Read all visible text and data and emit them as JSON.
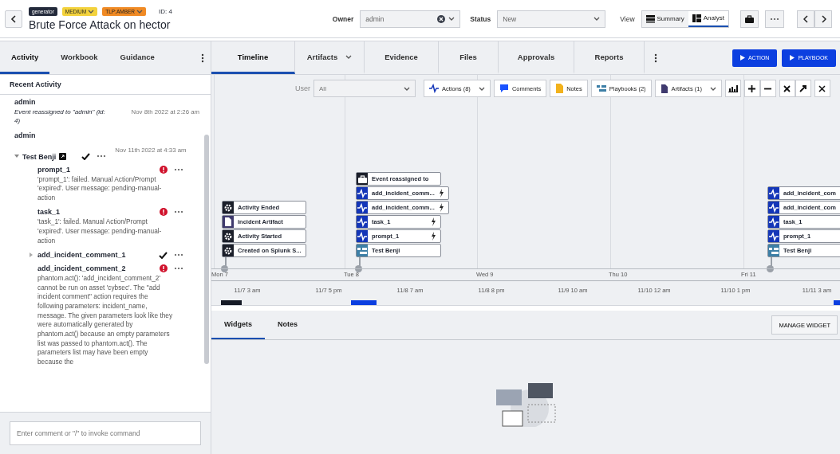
{
  "header": {
    "badges": [
      {
        "label": "generator",
        "kind": "tag",
        "color": "#232a3b"
      },
      {
        "label": "MEDIUM",
        "kind": "dropdown",
        "color": "#f3d23c"
      },
      {
        "label": "TLP:AMBER",
        "kind": "dropdown",
        "color": "#f08a24"
      }
    ],
    "id": "ID: 4",
    "title": "Brute Force Attack on hector",
    "owner": {
      "label": "Owner",
      "value": "admin"
    },
    "status": {
      "label": "Status",
      "value": "New"
    },
    "view": {
      "label": "View",
      "options": [
        {
          "label": "Summary",
          "kind": "summary",
          "selected": false
        },
        {
          "label": "Analyst",
          "kind": "analyst",
          "selected": true
        }
      ]
    }
  },
  "left_tabs": [
    {
      "label": "Activity",
      "selected": true
    },
    {
      "label": "Workbook",
      "selected": false
    },
    {
      "label": "Guidance",
      "selected": false
    }
  ],
  "recent_activity": {
    "title": "Recent Activity",
    "entries": [
      {
        "user": "admin",
        "kind": "message",
        "message": "Event reassigned to \"admin\" (id: 4)",
        "time": "Nov 8th 2022 at 2:26 am"
      },
      {
        "user": "admin",
        "kind": "playbook",
        "playbook": "Test Benji",
        "expanded": true,
        "failed": false,
        "time": "Nov 11th 2022 at 4:33 am",
        "children": [
          {
            "name": "prompt_1",
            "failed": true,
            "description": "'prompt_1': failed. Manual Action/Prompt 'expired'. User message: pending-manual-action"
          },
          {
            "name": "task_1",
            "failed": true,
            "description": "'task_1': failed. Manual Action/Prompt 'expired'. User message: pending-manual-action"
          },
          {
            "name": "add_incident_comment_1",
            "failed": false,
            "expanded": false
          },
          {
            "name": "add_incident_comment_2",
            "failed": true,
            "description": "phantom.act(): 'add_incident_comment_2' cannot be run on asset 'cybsec'. The \"add incident comment\" action requires the following parameters: incident_name, message. The given parameters look like they were automatically generated by phantom.act() because an empty parameters list was passed to phantom.act(). The parameters list may have been empty because the"
          }
        ]
      }
    ]
  },
  "comment": {
    "placeholder": "Enter comment or \"/\" to invoke command"
  },
  "main_tabs": [
    {
      "label": "Timeline",
      "selected": true,
      "dropdown": false
    },
    {
      "label": "Artifacts",
      "selected": false,
      "dropdown": true
    },
    {
      "label": "Evidence",
      "selected": false,
      "dropdown": false
    },
    {
      "label": "Files",
      "selected": false,
      "dropdown": false
    },
    {
      "label": "Approvals",
      "selected": false,
      "dropdown": false
    },
    {
      "label": "Reports",
      "selected": false,
      "dropdown": false
    }
  ],
  "buttons": [
    "ACTION",
    "PLAYBOOK"
  ],
  "timeline": {
    "user_filter": {
      "label": "User",
      "value": "All"
    },
    "filters": [
      {
        "label": "Actions (8)",
        "kind": "action",
        "dropdown": true
      },
      {
        "label": "Comments",
        "kind": "comment",
        "dropdown": false
      },
      {
        "label": "Notes",
        "kind": "note",
        "dropdown": false
      },
      {
        "label": "Playbooks (2)",
        "kind": "playbook",
        "dropdown": false
      },
      {
        "label": "Artifacts (1)",
        "kind": "artifact",
        "dropdown": true
      }
    ],
    "groups": [
      {
        "events": [
          {
            "label": "Activity Ended",
            "kind": "system",
            "bolt": false
          },
          {
            "label": "incident Artifact",
            "kind": "artifact",
            "bolt": false
          },
          {
            "label": "Activity Started",
            "kind": "system",
            "bolt": false
          },
          {
            "label": "Created on Splunk S...",
            "kind": "system",
            "bolt": false
          }
        ]
      },
      {
        "events": [
          {
            "label": "Event reassigned to",
            "kind": "assignment",
            "bolt": false
          },
          {
            "label": "add_incident_comm...",
            "kind": "action",
            "bolt": true
          },
          {
            "label": "add_incident_comm...",
            "kind": "action",
            "bolt": true
          },
          {
            "label": "task_1",
            "kind": "action",
            "bolt": true
          },
          {
            "label": "prompt_1",
            "kind": "action",
            "bolt": true
          },
          {
            "label": "Test Benji",
            "kind": "playbook",
            "bolt": false
          }
        ]
      },
      {
        "events": [
          {
            "label": "add_incident_com",
            "kind": "action",
            "bolt": false
          },
          {
            "label": "add_incident_com",
            "kind": "action",
            "bolt": false
          },
          {
            "label": "task_1",
            "kind": "action",
            "bolt": false
          },
          {
            "label": "prompt_1",
            "kind": "action",
            "bolt": false
          },
          {
            "label": "Test Benji",
            "kind": "playbook",
            "bolt": false
          }
        ]
      }
    ],
    "days": [
      "Mon 7",
      "Tue 8",
      "Wed 9",
      "Thu 10",
      "Fri 11"
    ],
    "times": [
      "11/7 3 am",
      "11/7 5 pm",
      "11/8 7 am",
      "11/8 8 pm",
      "11/9 10 am",
      "11/10 12 am",
      "11/10 1 pm",
      "11/11 3 am"
    ]
  },
  "bottom_tabs": [
    {
      "label": "Widgets",
      "selected": true
    },
    {
      "label": "Notes",
      "selected": false
    }
  ],
  "manage_button": "MANAGE WIDGET"
}
